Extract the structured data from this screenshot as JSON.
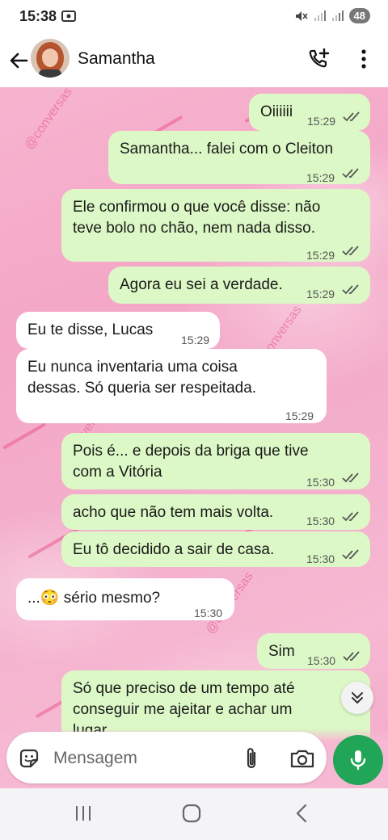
{
  "status_bar": {
    "time": "15:38",
    "battery": "48"
  },
  "header": {
    "contact_name": "Samantha"
  },
  "watermark": "@conversas",
  "messages": [
    {
      "dir": "out",
      "text": "Oiiiiii",
      "time": "15:29"
    },
    {
      "dir": "out",
      "text": "Samantha... falei com o Cleiton",
      "time": "15:29"
    },
    {
      "dir": "out",
      "lines": [
        "Ele confirmou o que você disse: não",
        "teve bolo no chão, nem nada disso."
      ],
      "time": "15:29"
    },
    {
      "dir": "out",
      "text": "Agora eu sei a verdade.",
      "time": "15:29"
    },
    {
      "dir": "in",
      "text": "Eu te disse, Lucas",
      "time": "15:29"
    },
    {
      "dir": "in",
      "lines": [
        "Eu nunca inventaria uma coisa",
        "dessas. Só queria ser respeitada."
      ],
      "time": "15:29"
    },
    {
      "dir": "out",
      "lines": [
        "Pois é... e depois da briga que tive",
        "com a Vitória"
      ],
      "time": "15:30"
    },
    {
      "dir": "out",
      "text": "acho que não tem mais volta.",
      "time": "15:30"
    },
    {
      "dir": "out",
      "text": "Eu tô decidido a sair de casa.",
      "time": "15:30"
    },
    {
      "dir": "in",
      "text_prefix": "...",
      "emoji": "😳",
      "text_suffix": " sério mesmo?",
      "time": "15:30"
    },
    {
      "dir": "out",
      "text": "Sim",
      "time": "15:30"
    },
    {
      "dir": "out",
      "lines": [
        "Só que preciso de um tempo até",
        "conseguir me ajeitar e achar um",
        "lugar"
      ]
    }
  ],
  "input": {
    "placeholder": "Mensagem"
  },
  "colors": {
    "outgoing_bubble": "#dcf8c6",
    "incoming_bubble": "#ffffff",
    "mic_button": "#21a556",
    "chat_background": "#f4a7c7"
  },
  "icons": [
    "back-arrow-icon",
    "add-call-icon",
    "more-vert-icon",
    "sticker-icon",
    "paperclip-icon",
    "camera-icon",
    "mic-icon",
    "double-chevron-down-icon"
  ]
}
